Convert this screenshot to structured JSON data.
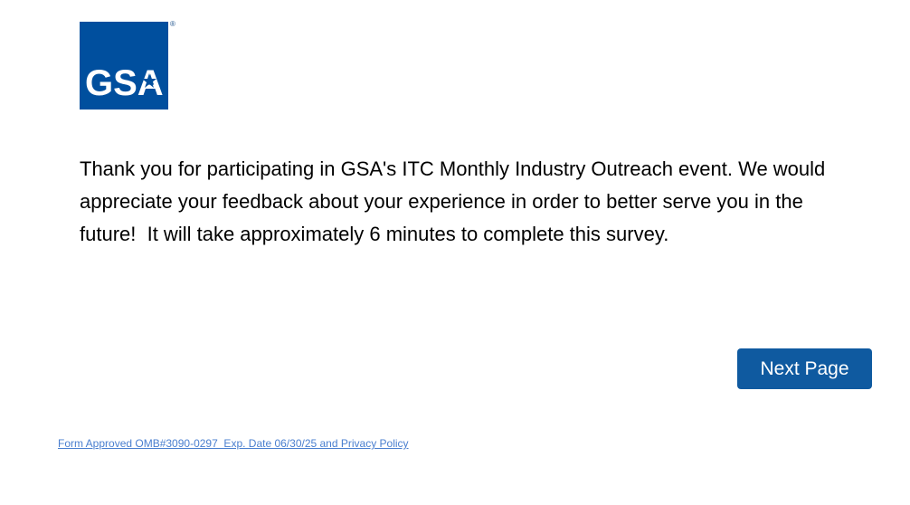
{
  "header": {
    "logo_text": "GSA",
    "logo_mark": "®",
    "logo_icon": "gsa-star-logo"
  },
  "main": {
    "intro_text": "Thank you for participating in GSA's ITC Monthly Industry Outreach event. We would appreciate your feedback about your experience in order to better serve you in the future!  It will take approximately 6 minutes to complete this survey."
  },
  "navigation": {
    "next_label": "Next Page"
  },
  "footer": {
    "link_text": "Form Approved OMB#3090-0297  Exp. Date 06/30/25 and Privacy Policy"
  },
  "colors": {
    "brand_blue": "#004f9e",
    "button_blue": "#0f5aa0",
    "link_blue": "#4a7fcf"
  }
}
